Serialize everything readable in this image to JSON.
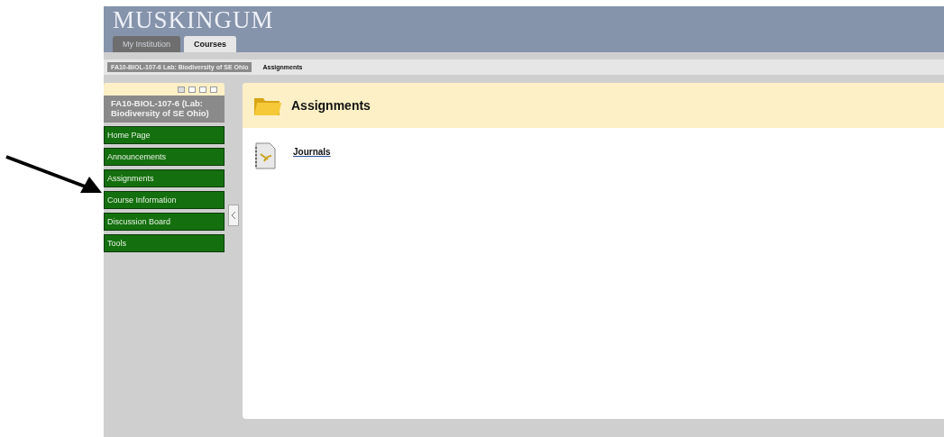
{
  "header": {
    "logo": "MUSKINGUM"
  },
  "tabs": [
    {
      "label": "My Institution",
      "selected": false
    },
    {
      "label": "Courses",
      "selected": true
    }
  ],
  "breadcrumbs": [
    "FA10-BIOL-107-6 Lab: Biodiversity of SE Ohio",
    "Assignments"
  ],
  "sidebar": {
    "course_title": "FA10-BIOL-107-6 (Lab: Biodiversity of SE Ohio)",
    "items": [
      {
        "label": "Home Page"
      },
      {
        "label": "Announcements"
      },
      {
        "label": "Assignments"
      },
      {
        "label": "Course Information"
      },
      {
        "label": "Discussion Board"
      },
      {
        "label": "Tools"
      }
    ]
  },
  "content": {
    "title": "Assignments",
    "items": [
      {
        "label": "Journals"
      }
    ]
  }
}
